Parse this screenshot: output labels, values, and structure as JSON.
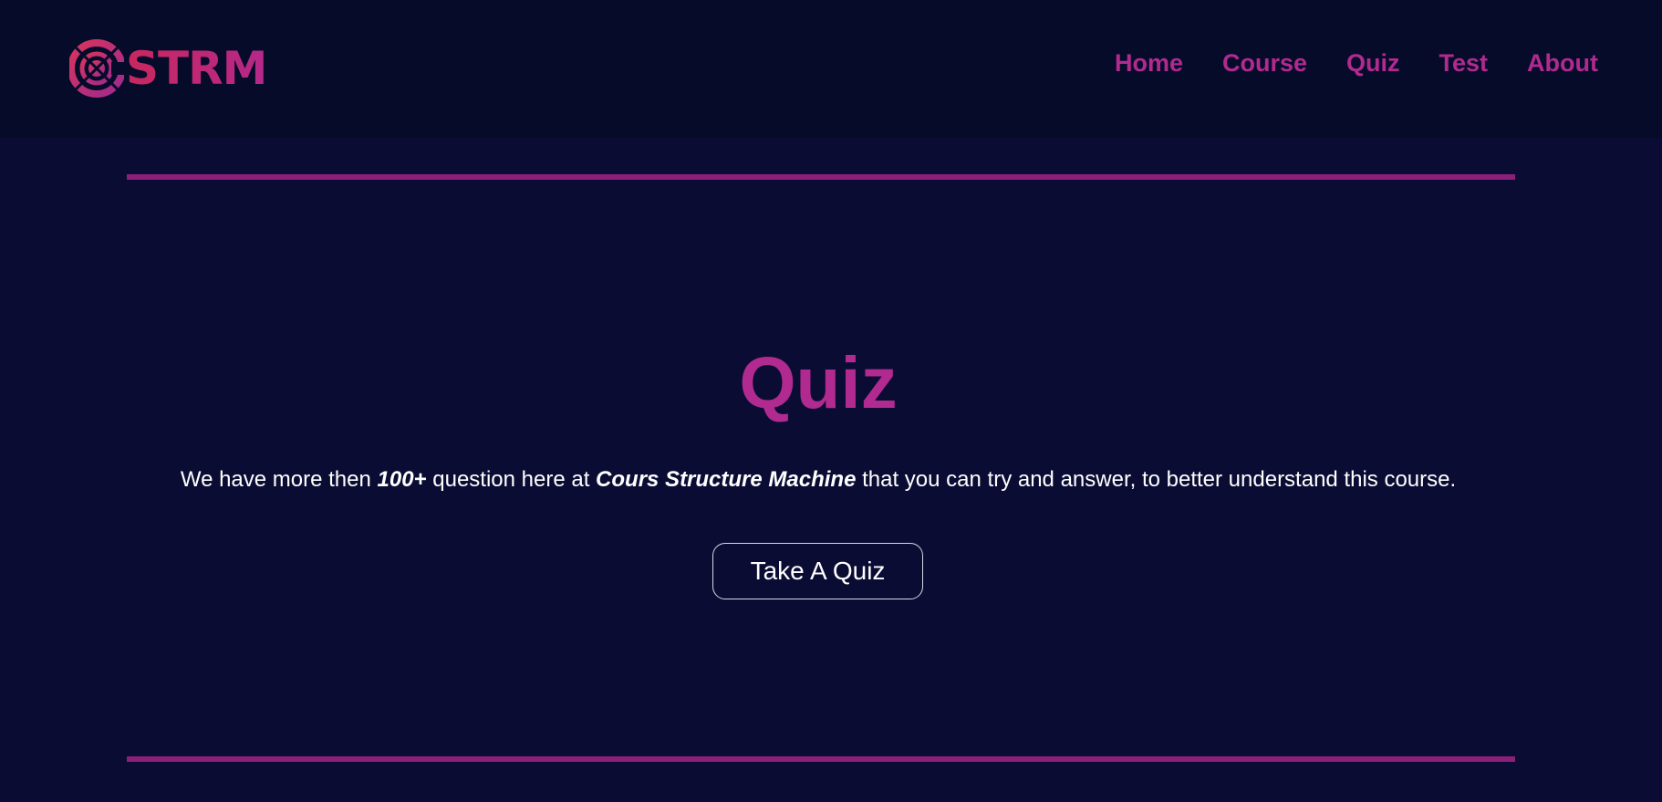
{
  "brand": {
    "logo_text": "STRM",
    "logo_icon": "target-rings-icon",
    "colors": {
      "primary": "#b02a8f",
      "logo_gradient_start": "#c8285e",
      "logo_gradient_end": "#b52889"
    }
  },
  "nav": {
    "items": [
      {
        "label": "Home"
      },
      {
        "label": "Course"
      },
      {
        "label": "Quiz"
      },
      {
        "label": "Test"
      },
      {
        "label": "About"
      }
    ]
  },
  "main": {
    "title": "Quiz",
    "description": {
      "part1": "We have more then ",
      "highlight1": "100+",
      "part2": " question here at ",
      "highlight2": "Cours Structure Machine",
      "part3": " that you can try and answer, to better understand this course."
    },
    "cta_label": "Take A Quiz"
  },
  "theme": {
    "background": "#0a0c33",
    "header_background": "#070b2a",
    "divider": "#8c2079",
    "text": "#ffffff"
  }
}
